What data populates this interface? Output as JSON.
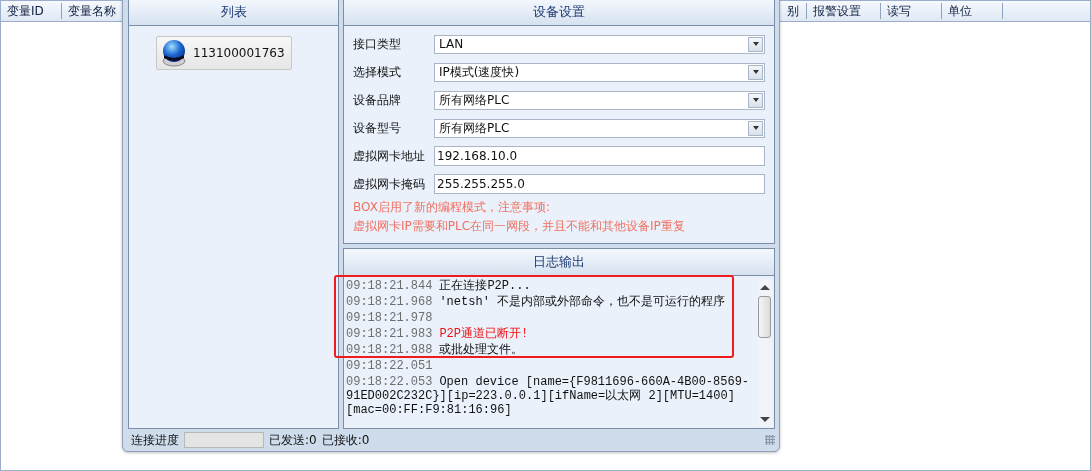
{
  "background_table": {
    "columns": [
      {
        "label": "变量ID"
      },
      {
        "label": "变量名称"
      },
      {
        "label": "别"
      },
      {
        "label": "报警设置"
      },
      {
        "label": "读写"
      },
      {
        "label": "单位"
      }
    ]
  },
  "dialog": {
    "list_panel": {
      "title": "列表",
      "devices": [
        {
          "label": "113100001763",
          "selected": false
        }
      ]
    },
    "settings_panel": {
      "title": "设备设置",
      "fields": [
        {
          "kind": "dropdown",
          "label": "接口类型",
          "value": "LAN"
        },
        {
          "kind": "dropdown",
          "label": "选择模式",
          "value": "IP模式(速度快)"
        },
        {
          "kind": "dropdown",
          "label": "设备品牌",
          "value": "所有网络PLC"
        },
        {
          "kind": "dropdown",
          "label": "设备型号",
          "value": "所有网络PLC"
        },
        {
          "kind": "text",
          "label": "虚拟网卡地址",
          "value": "192.168.10.0"
        },
        {
          "kind": "text",
          "label": "虚拟网卡掩码",
          "value": "255.255.255.0"
        }
      ],
      "notes": [
        "BOX启用了新的编程模式，注意事项:",
        "虚拟网卡IP需要和PLC在同一网段，并且不能和其他设备IP重复"
      ]
    },
    "log_panel": {
      "title": "日志输出",
      "entries": [
        {
          "time": "09:18:21.844",
          "message": "正在连接P2P...",
          "kind": "info"
        },
        {
          "time": "09:18:21.968",
          "message": "'netsh' 不是内部或外部命令，也不是可运行的程序",
          "kind": "info"
        },
        {
          "time": "09:18:21.978",
          "kind": "info"
        },
        {
          "time": "09:18:21.983",
          "message": "P2P通道已断开!",
          "kind": "error"
        },
        {
          "time": "09:18:21.988",
          "message": "或批处理文件。",
          "kind": "info"
        },
        {
          "time": "09:18:22.051",
          "kind": "info"
        },
        {
          "time": "09:18:22.053",
          "message": "Open device [name={F9811696-660A-4B00-8569-91ED002C232C}][ip=223.0.0.1][ifName=以太网 2][MTU=1400][mac=00:FF:F9:81:16:96]",
          "kind": "info"
        }
      ],
      "highlight": true
    },
    "status_bar": {
      "progress_label": "连接进度",
      "progress": {
        "level": 0
      },
      "sent": "已发送:0",
      "received": "已接收:0"
    }
  }
}
